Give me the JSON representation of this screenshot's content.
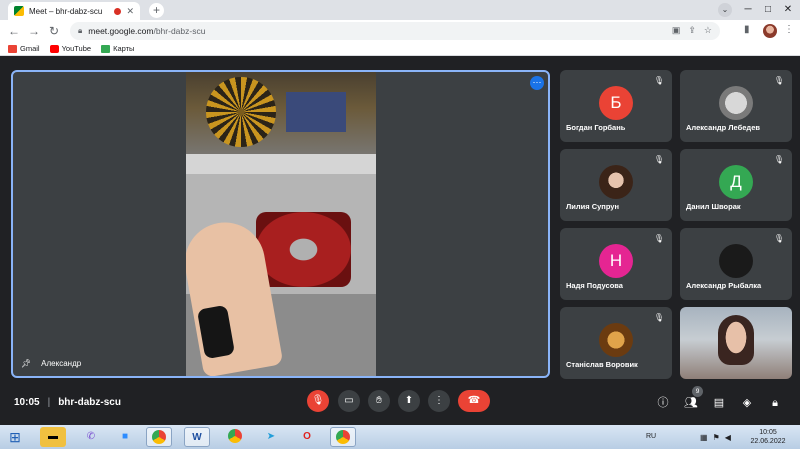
{
  "browser": {
    "tab_title": "Meet – bhr-dabz-scu",
    "url_host": "meet.google.com",
    "url_path": "/bhr-dabz-scu",
    "bookmarks": [
      {
        "label": "Gmail",
        "color": "#ea4335"
      },
      {
        "label": "YouTube",
        "color": "#ff0000"
      },
      {
        "label": "Карты",
        "color": "#34a853"
      }
    ]
  },
  "stage": {
    "presenter_name": "Александр"
  },
  "participants": [
    {
      "name": "Богдан Горбань",
      "initial": "Б",
      "color": "#ea4335"
    },
    {
      "name": "Александр Лебедев",
      "initial": "",
      "color": "#9aa0a6"
    },
    {
      "name": "Лилия Супрун",
      "initial": "",
      "color": "#5a3a2a"
    },
    {
      "name": "Данил Шворак",
      "initial": "Д",
      "color": "#34a853"
    },
    {
      "name": "Надя Подусова",
      "initial": "Н",
      "color": "#e52592"
    },
    {
      "name": "Александр Рыбалка",
      "initial": "",
      "color": "#1a1a1a"
    },
    {
      "name": "Станіслав Воровик",
      "initial": "",
      "color": "#c06a1a"
    }
  ],
  "meeting": {
    "time": "10:05",
    "code": "bhr-dabz-scu",
    "people_count": "9"
  },
  "taskbar": {
    "lang": "RU",
    "clock_time": "10:05",
    "clock_date": "22.06.2022"
  }
}
